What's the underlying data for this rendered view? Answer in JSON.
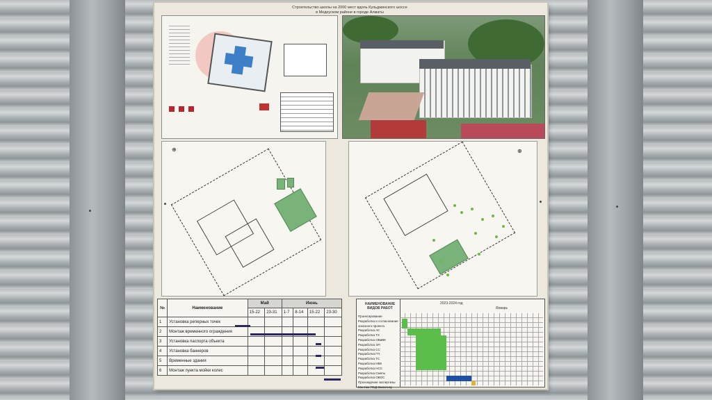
{
  "board": {
    "title_line1": "Строительство школы на 2000 мест вдоль Кульджинского шоссе",
    "title_line2": "в Медеуском районе в городе Алматы"
  },
  "schedule_left": {
    "col_num": "№",
    "col_name": "Наименование",
    "month_may": "Май",
    "month_june": "Июнь",
    "periods": [
      "15-22",
      "23-31",
      "1-7",
      "8-14",
      "15-22",
      "23-30"
    ],
    "rows": [
      {
        "num": "1",
        "name": "Установка реперных точек"
      },
      {
        "num": "2",
        "name": "Монтаж временного ограждения"
      },
      {
        "num": "3",
        "name": "Установка паспорта объекта"
      },
      {
        "num": "4",
        "name": "Установка баннеров"
      },
      {
        "num": "5",
        "name": "Временные здания"
      },
      {
        "num": "6",
        "name": "Монтаж пункта мойки колес"
      }
    ]
  },
  "schedule_right": {
    "col_name": "НАИМЕНОВАНИЕ ВИДОВ РАБОТ",
    "year": "2023-2024 год",
    "month": "Январь",
    "rows": [
      "Проектирование",
      "Разработка и согласование эскизного проекта",
      "Разработка АС",
      "Разработка ТХ",
      "Разработка ОВиВК",
      "Разработка ЭП",
      "Разработка СС",
      "Разработка ГП",
      "Разработка ТС",
      "Разработка НВК",
      "Разработка НСС",
      "Разработка Сметы",
      "Разработка ОВОС",
      "Прохождение экспертизы",
      "Монтаж ПСД Заказчику"
    ]
  },
  "colors": {
    "green": "#5bbd4a",
    "blue": "#1e4fa6",
    "yellow": "#e5b22b",
    "bar": "#2b2560"
  }
}
